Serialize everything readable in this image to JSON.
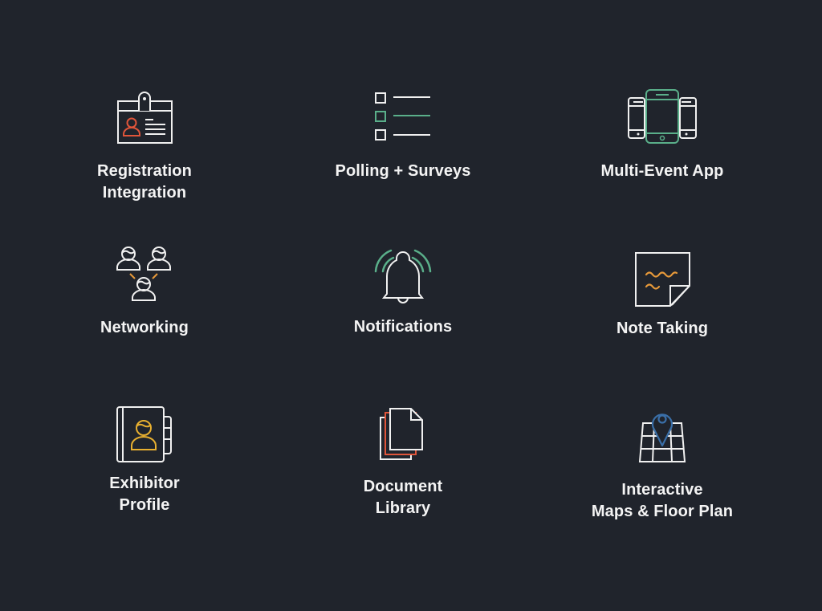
{
  "colors": {
    "background": "#20242c",
    "stroke": "#f0f0f0",
    "accent_red": "#e0553a",
    "accent_green": "#5aaf8a",
    "accent_orange": "#e89a3a",
    "accent_yellow": "#e8b030",
    "accent_blue": "#3a6fa8"
  },
  "features": [
    {
      "id": "registration",
      "icon": "id-badge-icon",
      "label_lines": [
        "Registration",
        "Integration"
      ]
    },
    {
      "id": "polling",
      "icon": "checklist-icon",
      "label_lines": [
        "Polling + Surveys"
      ]
    },
    {
      "id": "multi-event",
      "icon": "mobile-devices-icon",
      "label_lines": [
        "Multi-Event App"
      ]
    },
    {
      "id": "networking",
      "icon": "people-network-icon",
      "label_lines": [
        "Networking"
      ]
    },
    {
      "id": "notifications",
      "icon": "bell-icon",
      "label_lines": [
        "Notifications"
      ]
    },
    {
      "id": "note-taking",
      "icon": "sticky-note-icon",
      "label_lines": [
        "Note Taking"
      ]
    },
    {
      "id": "exhibitor",
      "icon": "contact-book-icon",
      "label_lines": [
        "Exhibitor",
        "Profile"
      ]
    },
    {
      "id": "document-library",
      "icon": "documents-icon",
      "label_lines": [
        "Document",
        "Library"
      ]
    },
    {
      "id": "maps",
      "icon": "map-pin-icon",
      "label_lines": [
        "Interactive",
        "Maps & Floor Plan"
      ]
    }
  ]
}
